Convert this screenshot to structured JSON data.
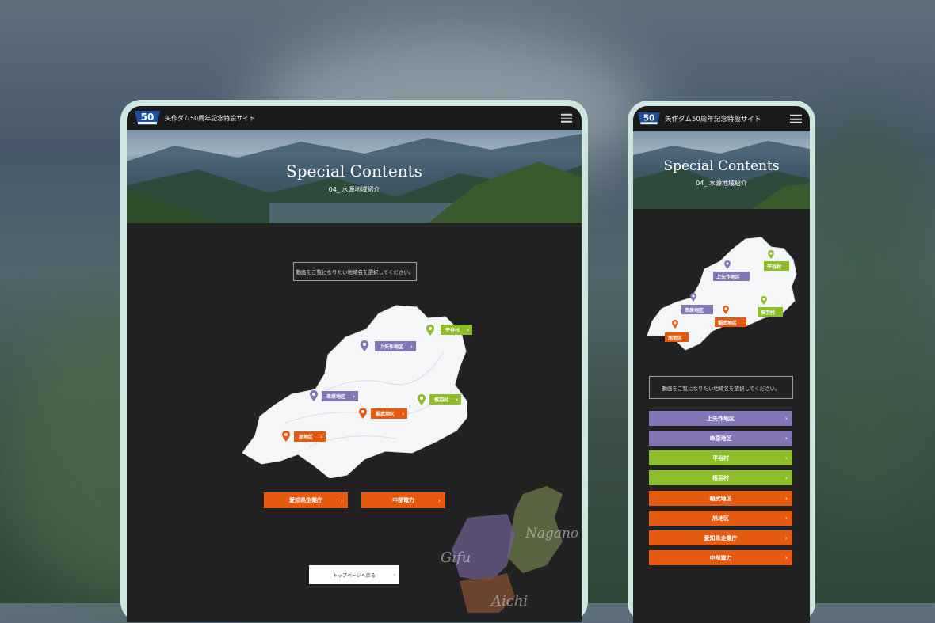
{
  "site": {
    "title": "矢作ダム50周年記念特設サイト",
    "logo_number": "50",
    "logo_caption": "YAHAGI DAM"
  },
  "hero": {
    "title": "Special Contents",
    "subtitle": "04_ 水源地域紹介"
  },
  "prompt_text": "動画をご覧になりたい地域名を選択してください。",
  "map_pins": [
    {
      "label": "平谷村",
      "color": "green"
    },
    {
      "label": "上矢作地区",
      "color": "purple"
    },
    {
      "label": "串原地区",
      "color": "purple"
    },
    {
      "label": "根羽村",
      "color": "green"
    },
    {
      "label": "稲武地区",
      "color": "orange"
    },
    {
      "label": "旭地区",
      "color": "orange"
    }
  ],
  "bottom_buttons": [
    "愛知県企業庁",
    "中部電力"
  ],
  "mobile_buttons": [
    {
      "label": "上矢作地区",
      "color": "purple"
    },
    {
      "label": "串原地区",
      "color": "purple"
    },
    {
      "label": "平谷村",
      "color": "green"
    },
    {
      "label": "根羽村",
      "color": "green"
    },
    {
      "label": "稲武地区",
      "color": "orange"
    },
    {
      "label": "旭地区",
      "color": "orange"
    },
    {
      "label": "愛知県企業庁",
      "color": "orange"
    },
    {
      "label": "中部電力",
      "color": "orange"
    }
  ],
  "top_page_link": "トップページへ戻る",
  "prefectures": [
    "Gifu",
    "Nagano",
    "Aichi"
  ],
  "colors": {
    "purple": "#8476b6",
    "green": "#8dbd28",
    "orange": "#e65a0f",
    "screen_bg": "#232222",
    "frame": "#cfe6de"
  }
}
